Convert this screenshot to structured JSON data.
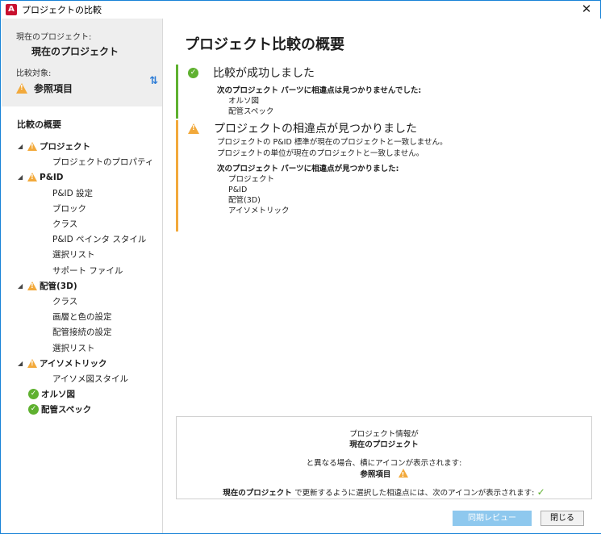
{
  "window": {
    "title": "プロジェクトの比較",
    "app_icon_letter": "A",
    "close_glyph": "✕"
  },
  "left": {
    "current_label": "現在のプロジェクト:",
    "current_value": "現在のプロジェクト",
    "target_label": "比較対象:",
    "target_value": "参照項目",
    "swap_glyph": "⇅",
    "tree_title": "比較の概要",
    "tree": [
      {
        "label": "プロジェクト",
        "status": "warn",
        "children": [
          "プロジェクトのプロパティ"
        ]
      },
      {
        "label": "P&ID",
        "status": "warn",
        "children": [
          "P&ID 設定",
          "ブロック",
          "クラス",
          "P&ID ペインタ スタイル",
          "選択リスト",
          "サポート ファイル"
        ]
      },
      {
        "label": "配管(3D)",
        "status": "warn",
        "children": [
          "クラス",
          "画層と色の設定",
          "配管接続の設定",
          "選択リスト"
        ]
      },
      {
        "label": "アイソメトリック",
        "status": "warn",
        "children": [
          "アイソメ図スタイル"
        ]
      },
      {
        "label": "オルソ図",
        "status": "ok",
        "children": []
      },
      {
        "label": "配管スペック",
        "status": "ok",
        "children": []
      }
    ]
  },
  "main": {
    "title": "プロジェクト比較の概要",
    "success": {
      "heading": "比較が成功しました",
      "subheading": "次のプロジェクト パーツに相違点は見つかりませんでした:",
      "items": [
        "オルソ図",
        "配管スペック"
      ]
    },
    "differences": {
      "heading": "プロジェクトの相違点が見つかりました",
      "lines": [
        "プロジェクトの P&ID 標準が現在のプロジェクトと一致しません。",
        "プロジェクトの単位が現在のプロジェクトと一致しません。"
      ],
      "subheading": "次のプロジェクト パーツに相違点が見つかりました:",
      "items": [
        "プロジェクト",
        "P&ID",
        "配管(3D)",
        "アイソメトリック"
      ]
    },
    "info": {
      "line1": "プロジェクト情報が",
      "line2": "現在のプロジェクト",
      "line3": "と異なる場合、横にアイコンが表示されます:",
      "line4": "参照項目",
      "line5_prefix": "現在のプロジェクト",
      "line5_rest": "で更新するように選択した相違点には、次のアイコンが表示されます:"
    },
    "buttons": {
      "sync": "同期レビュー",
      "close": "閉じる"
    }
  }
}
